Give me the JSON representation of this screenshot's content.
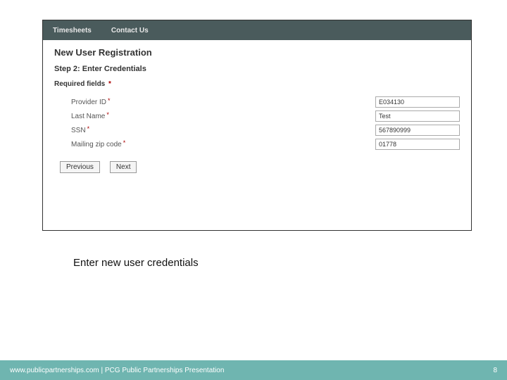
{
  "header": {
    "nav": [
      "Timesheets",
      "Contact Us"
    ]
  },
  "form": {
    "title": "New User Registration",
    "step": "Step 2: Enter Credentials",
    "required_note": "Required fields",
    "fields": [
      {
        "label": "Provider ID",
        "required": true,
        "value": "E034130"
      },
      {
        "label": "Last Name",
        "required": true,
        "value": "Test"
      },
      {
        "label": "SSN",
        "required": true,
        "value": "567890999"
      },
      {
        "label": "Mailing zip code",
        "required": true,
        "value": "01778"
      }
    ],
    "buttons": {
      "previous": "Previous",
      "next": "Next"
    }
  },
  "caption": "Enter new user credentials",
  "footer": {
    "left": "www.publicpartnerships.com | PCG Public Partnerships Presentation",
    "right": "8"
  }
}
